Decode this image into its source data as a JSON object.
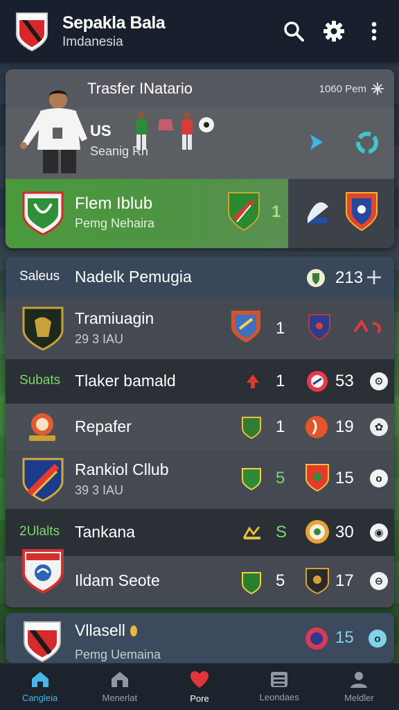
{
  "header": {
    "title": "Sepakla Bala",
    "subtitle": "Imdanesia",
    "icons": [
      "search-icon",
      "gear-icon",
      "more-vertical-icon"
    ]
  },
  "featured": {
    "title": "Trasfer INatario",
    "meta": "1060 Pem",
    "score_label": "US",
    "score_sub": "Seanig Rh",
    "club": {
      "name": "Flem Iblub",
      "sub": "Pemg Nehaira",
      "score": "1"
    }
  },
  "table": {
    "header": {
      "label": "Saleus",
      "title": "Nadelk Pemugia",
      "value": "213"
    },
    "rows": [
      {
        "name": "Tramiuagin",
        "sub": "29 3 IAU",
        "score": "1"
      },
      {
        "label": "Subats",
        "name": "Tlaker bamald",
        "score": "1",
        "value": "53"
      },
      {
        "name": "Repafer",
        "score": "1",
        "value": "19"
      },
      {
        "name": "Rankiol Cllub",
        "sub": "39 3 IAU",
        "score": "5",
        "value": "15"
      },
      {
        "label": "2Ulalts",
        "name": "Tankana",
        "score": "S",
        "value": "30"
      },
      {
        "name": "Ildam Seote",
        "score": "5",
        "value": "17"
      }
    ]
  },
  "bottom_card": {
    "name": "Vllasell",
    "sub": "Pemg Uemaina",
    "value": "15"
  },
  "nav": [
    {
      "label": "Cangleia",
      "icon": "home-icon",
      "active": true
    },
    {
      "label": "Menerlat",
      "icon": "building-icon",
      "active": false
    },
    {
      "label": "Pore",
      "icon": "heart-icon",
      "active": false
    },
    {
      "label": "Leondaes",
      "icon": "list-icon",
      "active": false
    },
    {
      "label": "Meldler",
      "icon": "user-icon",
      "active": false
    }
  ],
  "colors": {
    "accent": "#45b6e8",
    "green": "#4a9a3c",
    "heart": "#e0353a",
    "topbar": "#17202c"
  }
}
